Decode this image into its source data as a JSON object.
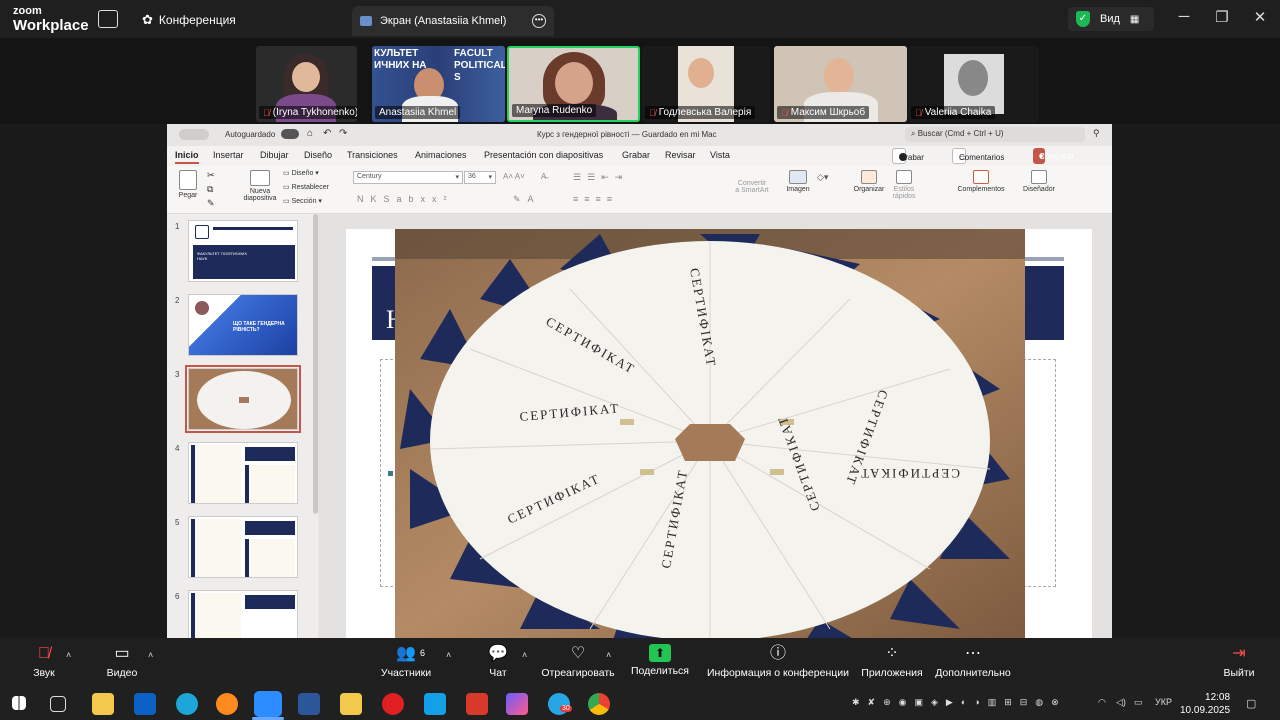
{
  "zoom": {
    "brand_top": "zoom",
    "brand_bottom": "Workplace",
    "conference_label": "Конференция",
    "screen_tab_label": "Экран (Anastasiia Khmel)",
    "view_label": "Вид"
  },
  "participants": [
    {
      "name": "(Iryna Tykhonenko)",
      "muted": true
    },
    {
      "name": "Anastasiia Khmel",
      "muted": false
    },
    {
      "name": "Maryna Rudenko",
      "muted": false,
      "active_speaker": true
    },
    {
      "name": "Годлевська Валерія",
      "muted": true
    },
    {
      "name": "Максим Шкрьоб",
      "muted": true
    },
    {
      "name": "Valeriia Chaika",
      "muted": true
    }
  ],
  "backdrop_text": {
    "line1": "КУЛЬТЕТ",
    "line2": "ИЧНИХ НА",
    "line3": "FACULT",
    "line4": "POLITICAL S"
  },
  "powerpoint": {
    "autosave_label": "Autoguardado",
    "doc_title": "Курс з гендерної рівності — Guardado en mi Mac",
    "search_placeholder": "Buscar (Cmd + Ctrl + U)",
    "tabs": [
      "Inicio",
      "Insertar",
      "Dibujar",
      "Diseño",
      "Transiciones",
      "Animaciones",
      "Presentación con diapositivas",
      "Grabar",
      "Revisar",
      "Vista"
    ],
    "active_tab": "Inicio",
    "record_btn": "Grabar",
    "comments_btn": "Comentarios",
    "share_btn": "Compartir",
    "ribbon": {
      "paste": "Pegar",
      "new_slide_line1": "Nueva",
      "new_slide_line2": "diapositiva",
      "layout": "Diseño",
      "reset": "Restablecer",
      "section": "Sección",
      "font_name": "Century",
      "font_size": "36",
      "convert_line1": "Convertir",
      "convert_line2": "a SmartArt",
      "image": "Imagen",
      "arrange": "Organizar",
      "quick_styles_line1": "Estilos",
      "quick_styles_line2": "rápidos",
      "addins": "Complementos",
      "designer": "Diseñador"
    },
    "slide_numbers": [
      "1",
      "2",
      "3",
      "4",
      "5",
      "6"
    ],
    "selected_slide": "3",
    "slide1_text": "ФАКУЛЬТЕТ ПОЛІТИЧНИХ НАУК",
    "slide2_text": "ЩО ТАКЕ ГЕНДЕРНА РІВНІСТЬ?",
    "slide_heading_fragment": "Н",
    "certificate_word": "СЕРТИФІКАТ"
  },
  "toolbar": {
    "audio": "Звук",
    "video": "Видео",
    "participants": "Участники",
    "participants_count": "6",
    "chat": "Чат",
    "react": "Отреагировать",
    "share": "Поделиться",
    "info": "Информация о конференции",
    "apps": "Приложения",
    "more": "Дополнительно",
    "leave": "Выйти"
  },
  "taskbar": {
    "lang": "УКР",
    "time": "12:08",
    "date": "10.09.2025",
    "telegram_badge": "30"
  },
  "colors": {
    "zoom_bg": "#1f1f1f",
    "active_speaker": "#23d160",
    "ppt_accent": "#c4564a",
    "slide_navy": "#1e2a5a",
    "share_green": "#23c552"
  }
}
